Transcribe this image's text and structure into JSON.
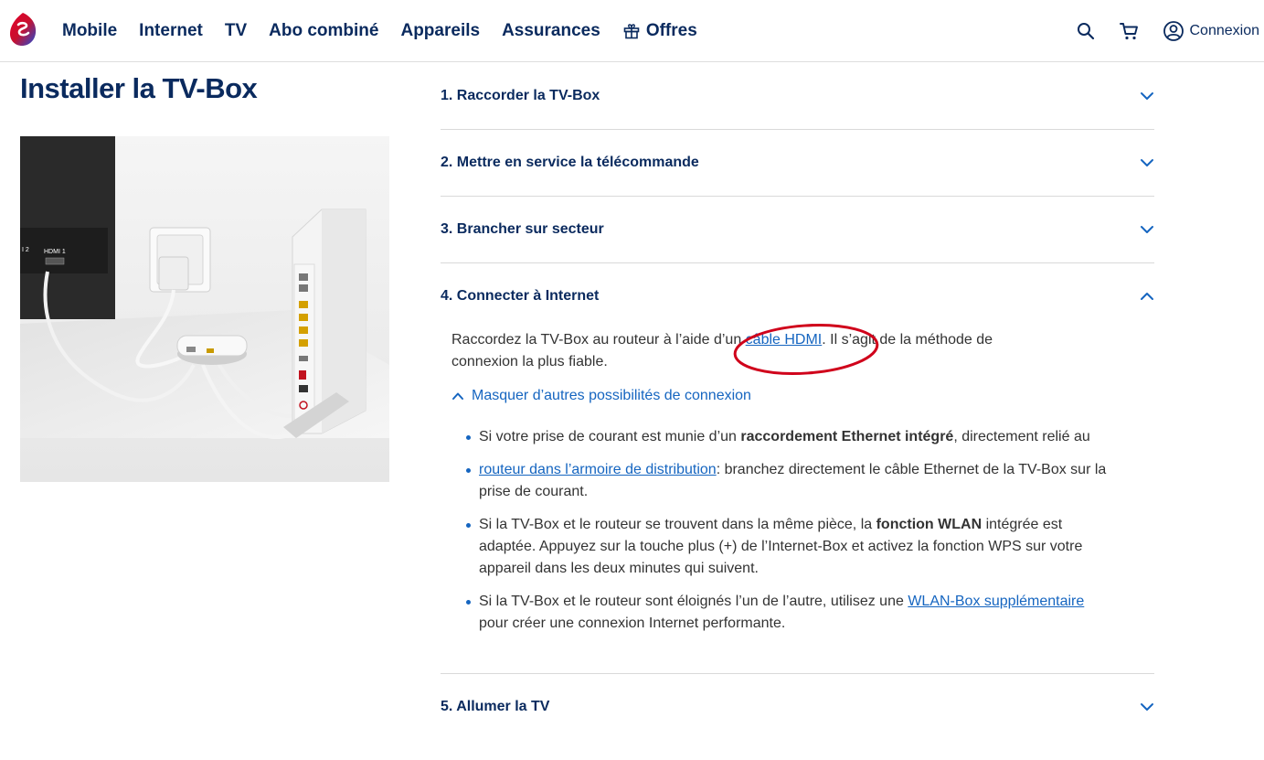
{
  "header": {
    "nav": [
      {
        "label": "Mobile"
      },
      {
        "label": "Internet"
      },
      {
        "label": "TV"
      },
      {
        "label": "Abo combiné"
      },
      {
        "label": "Appareils"
      },
      {
        "label": "Assurances"
      },
      {
        "label": "Offres",
        "icon": "gift-icon"
      }
    ],
    "account_label": "Connexion",
    "icons": [
      "search-icon",
      "cart-icon",
      "user-icon"
    ],
    "brand_color": "#0a2a5e"
  },
  "page_title": "Installer la TV-Box",
  "illustration_labels": {
    "hdmi1": "HDMI 1",
    "hdmi2": "I 2"
  },
  "accordion": {
    "items": [
      {
        "title": "1. Raccorder la TV-Box",
        "expanded": false
      },
      {
        "title": "2. Mettre en service la télécommande",
        "expanded": false
      },
      {
        "title": "3. Brancher sur secteur",
        "expanded": false
      },
      {
        "title": "4. Connecter à Internet",
        "expanded": true
      },
      {
        "title": "5. Allumer la TV",
        "expanded": false
      }
    ],
    "step4": {
      "text_before": "Raccordez la TV-Box au routeur à l’aide d’un ",
      "link_hdmi": "câble HDMI",
      "text_after": ". Il s’agit de la méthode de connexion la plus fiable.",
      "toggle_label": "Masquer d’autres possibilités de connexion",
      "options": [
        {
          "p1": "Si votre prise de courant est munie d’un ",
          "bold": "raccordement Ethernet intégré",
          "p2": ", directement relié au"
        },
        {
          "link": "routeur dans l’armoire de distribution",
          "p1": ": branchez directement le câble Ethernet de la TV-Box sur la prise de courant."
        },
        {
          "p1": "Si la TV-Box et le routeur se trouvent dans la même pièce, la ",
          "bold": "fonction WLAN",
          "p2": " intégrée est adaptée. Appuyez sur la touche plus (+) de l’Internet-Box et activez la fonction WPS sur votre appareil dans les deux minutes qui suivent."
        },
        {
          "p1": "Si la TV-Box et le routeur sont éloignés l’un de l’autre, utilisez une ",
          "link": "WLAN-Box supplémentaire",
          "p2": " pour créer une connexion Internet performante."
        }
      ]
    }
  },
  "colors": {
    "link": "#1565c0",
    "annotation": "#d0021b",
    "divider": "#d9d9d9"
  }
}
